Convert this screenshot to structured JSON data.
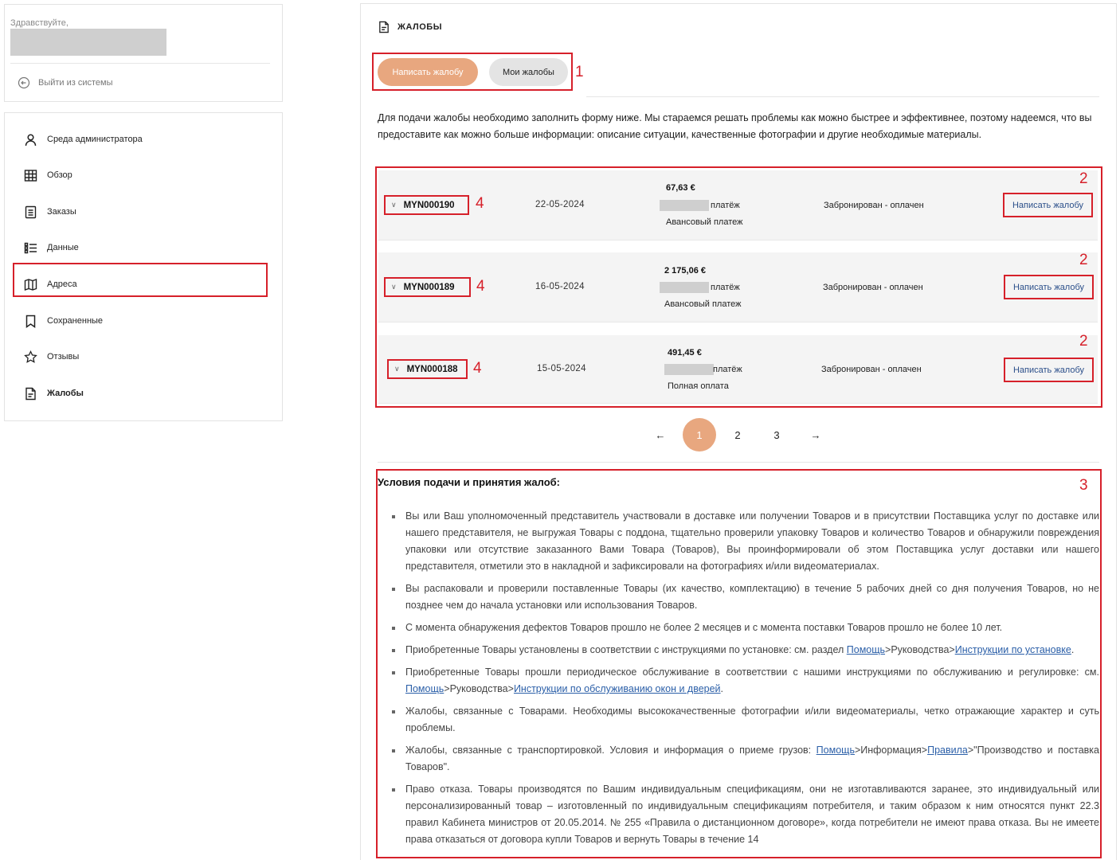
{
  "user": {
    "greeting": "Здравствуйте,",
    "logout_label": "Выйти из системы"
  },
  "sidebar": {
    "items": [
      {
        "label": "Среда администратора",
        "icon": "user-icon"
      },
      {
        "label": "Обзор",
        "icon": "grid-icon"
      },
      {
        "label": "Заказы",
        "icon": "document-icon"
      },
      {
        "label": "Данные",
        "icon": "list-icon"
      },
      {
        "label": "Адреса",
        "icon": "map-icon"
      },
      {
        "label": "Сохраненные",
        "icon": "bookmark-icon"
      },
      {
        "label": "Отзывы",
        "icon": "star-icon"
      },
      {
        "label": "Жалобы",
        "icon": "complaint-icon",
        "active": true
      }
    ]
  },
  "page": {
    "title": "ЖАЛОБЫ",
    "tabs": {
      "write": "Написать жалобу",
      "mine": "Мои жалобы"
    },
    "intro": "Для подачи жалобы необходимо заполнить форму ниже. Мы стараемся решать проблемы как можно быстрее и эффективнее, поэтому надеемся, что вы предоставите как можно больше информации: описание ситуации, качественные фотографии и другие необходимые материалы."
  },
  "markers": {
    "tabs": "1",
    "complaint": "2",
    "conditions": "3",
    "order_id": "4"
  },
  "orders": [
    {
      "id": "MYN000190",
      "date": "22-05-2024",
      "amount": "67,63 €",
      "payment": "платёж",
      "payment_type": "Авансовый платеж",
      "status": "Забронирован - оплачен",
      "action": "Написать жалобу"
    },
    {
      "id": "MYN000189",
      "date": "16-05-2024",
      "amount": "2 175,06 €",
      "payment": "платёж",
      "payment_type": "Авансовый платеж",
      "status": "Забронирован - оплачен",
      "action": "Написать жалобу"
    },
    {
      "id": "MYN000188",
      "date": "15-05-2024",
      "amount": "491,45 €",
      "payment": "платёж",
      "payment_type": "Полная оплата",
      "status": "Забронирован - оплачен",
      "action": "Написать жалобу"
    }
  ],
  "pagination": {
    "prev": "←",
    "pages": [
      "1",
      "2",
      "3"
    ],
    "current": "1",
    "next": "→"
  },
  "conditions": {
    "title": "Условия подачи и принятия жалоб:",
    "items": [
      {
        "text": "Вы или Ваш уполномоченный представитель участвовали в доставке или получении Товаров и в присутствии Поставщика услуг по доставке или нашего представителя, не выгружая Товары с поддона, тщательно проверили упаковку Товаров и количество Товаров и обнаружили повреждения упаковки или отсутствие заказанного Вами Товара (Товаров), Вы проинформировали об этом Поставщика услуг доставки или нашего представителя, отметили это в накладной и зафиксировали на фотографиях и/или видеоматериалах."
      },
      {
        "text": "Вы распаковали и проверили поставленные Товары (их качество, комплектацию) в течение 5 рабочих дней со дня получения Товаров, но не позднее чем до начала установки или использования Товаров."
      },
      {
        "text": "С момента обнаружения дефектов Товаров прошло не более 2 месяцев и с момента поставки Товаров прошло не более 10 лет."
      },
      {
        "pre": "Приобретенные Товары установлены в соответствии с инструкциями по установке: см. раздел ",
        "link1": "Помощь",
        "mid": ">Руководства>",
        "link2": "Инструкции по установке",
        "post": "."
      },
      {
        "pre": "Приобретенные Товары прошли периодическое обслуживание в соответствии с нашими инструкциями по обслуживанию и регулировке: см. ",
        "link1": "Помощь",
        "mid": ">Руководства>",
        "link2": "Инструкции по обслуживанию окон и дверей",
        "post": "."
      },
      {
        "text": "Жалобы, связанные с Товарами. Необходимы высококачественные фотографии и/или видеоматериалы, четко отражающие характер и суть проблемы."
      },
      {
        "pre": "Жалобы, связанные с транспортировкой. Условия и информация о приеме грузов: ",
        "link1": "Помощь",
        "mid": ">Информация>",
        "link2": "Правила",
        "post": ">\"Производство и поставка Товаров\"."
      },
      {
        "text": "Право отказа. Товары производятся по Вашим индивидуальным спецификациям, они не изготавливаются заранее, это индивидуальный или персонализированный товар – изготовленный по индивидуальным спецификациям потребителя, и таким образом к ним относятся пункт 22.3 правил Кабинета министров от 20.05.2014. № 255 «Правила о дистанционном договоре», когда потребители не имеют права отказа. Вы не имеете права отказаться от договора купли Товаров и вернуть Товары в течение 14"
      }
    ]
  },
  "colors": {
    "accent": "#e8a77f",
    "annotation": "#d6202a",
    "link": "#2b5fa8"
  }
}
